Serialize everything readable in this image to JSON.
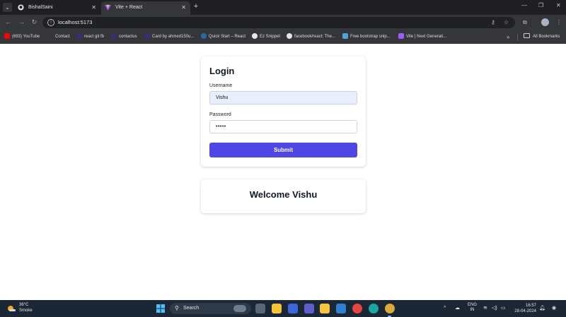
{
  "browser": {
    "tabs": [
      {
        "title": "BishalSaini",
        "active": false,
        "icon": "github-icon"
      },
      {
        "title": "Vite + React",
        "active": true,
        "icon": "vite-icon"
      }
    ],
    "new_tab": "+",
    "window_controls": {
      "minimize": "—",
      "maximize": "❐",
      "close": "✕"
    },
    "address": "localhost:5173",
    "bookmarks": [
      {
        "label": "(693) YouTube",
        "icon": "youtube-icon",
        "color": "#ff0000"
      },
      {
        "label": "Contact",
        "icon": "page-icon",
        "color": "#35363a"
      },
      {
        "label": "react git fb",
        "icon": "lab-icon",
        "color": "#3b2d6e"
      },
      {
        "label": "contactus",
        "icon": "lab-icon",
        "color": "#3b2d6e"
      },
      {
        "label": "Card by ahmed150u...",
        "icon": "lab-icon",
        "color": "#3b2d6e"
      },
      {
        "label": "Quick Start – React",
        "icon": "react-icon",
        "color": "#1d6fa3"
      },
      {
        "label": "Ez Snippet",
        "icon": "triangle-icon",
        "color": "#111111"
      },
      {
        "label": "facebook/react: The...",
        "icon": "github-icon",
        "color": "#e6e6e6"
      },
      {
        "label": "Free bootstrap snip...",
        "icon": "bootstrap-icon",
        "color": "#4fa3d9"
      },
      {
        "label": "Vite | Next Generati...",
        "icon": "vite-icon",
        "color": "#a259ff"
      }
    ],
    "bookmarks_more": "»",
    "all_bookmarks": "All Bookmarks"
  },
  "login": {
    "title": "Login",
    "username_label": "Username",
    "username_value": "Vishu",
    "password_label": "Password",
    "password_value": "•••••",
    "submit_label": "Submit"
  },
  "welcome": {
    "text": "Welcome Vishu"
  },
  "taskbar": {
    "weather_temp": "36°C",
    "weather_condition": "Smoke",
    "search_label": "Search",
    "lang_line1": "ENG",
    "lang_line2": "IN",
    "time": "16:57",
    "date": "28-04-2024"
  },
  "colors": {
    "accent": "#4f46e5",
    "taskbar": "#1b2735",
    "browser_chrome": "#35363a"
  }
}
